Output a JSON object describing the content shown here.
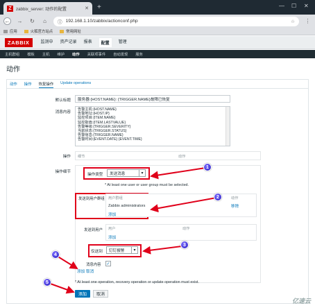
{
  "browser": {
    "tab_title": "zabbix_server: 动作的配置",
    "url": "192.168.1.10/zabbix/actionconf.php",
    "bookmarks": [
      "应用",
      "火狐官方站点",
      "常用网址"
    ]
  },
  "zabbix": {
    "logo": "ZABBIX",
    "top_menu": [
      "监测中",
      "资产记录",
      "报表",
      "配置",
      "管理"
    ],
    "top_menu_active": "配置",
    "sub_menu": [
      "主机群组",
      "模板",
      "主机",
      "维护",
      "动作",
      "关联项事件",
      "自动发现",
      "服务"
    ],
    "sub_menu_active": "动作",
    "page_title": "动作",
    "tabs": [
      "动作",
      "操作",
      "恢复操作",
      "Update operations"
    ],
    "active_tab": "恢复操作"
  },
  "form": {
    "default_subject_label": "默认标题",
    "default_subject": "服务器:{HOST.NAME}: {TRIGGER.NAME}故障已恢复",
    "message_label": "消息内容",
    "message_lines": [
      "告警主机:{HOST.NAME}",
      "告警地址:{HOST.IP}",
      "监控项目:{ITEM.NAME}",
      "监控取值:{ITEM.LASTVALUE}",
      "告警等级:{TRIGGER.SEVERITY}",
      "当前状态:{TRIGGER.STATUS}",
      "告警信息:{TRIGGER.NAME}",
      "告警时间:{EVENT.DATE} {EVENT.TIME}"
    ],
    "operations_label": "操作",
    "operations_col_details": "细节",
    "operations_col_action": "动作",
    "op_details_label": "操作细节",
    "op_type_label": "操作类型",
    "op_type_value": "发送消息",
    "at_least_note": "* At least one user or user group must be selected.",
    "send_groups_label": "发送到用户群组",
    "groups_col_group": "用户群组",
    "groups_col_action": "动作",
    "group_entry": "Zabbix administrators",
    "group_remove": "移除",
    "add_link": "添加",
    "send_users_label": "发送到用户",
    "users_col_user": "用户",
    "users_col_action": "动作",
    "users_add": "添加",
    "send_only_label": "仅送到",
    "send_only_value": "钉钉报警",
    "custom_msg_label": "消息内容",
    "add_btn": "添加",
    "cancel_link": "取消",
    "bottom_note": "* At least one operation, recovery operation or update operation must exist.",
    "submit_add": "添加",
    "submit_cancel": "取消"
  },
  "annotations": [
    "1",
    "2",
    "3",
    "4",
    "5"
  ],
  "watermark": "亿速云"
}
